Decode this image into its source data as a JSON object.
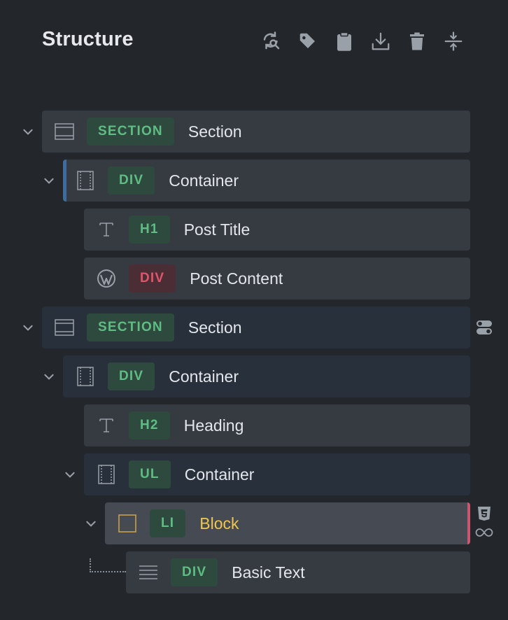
{
  "panel": {
    "title": "Structure"
  },
  "toolbar": [
    {
      "name": "refresh-search-icon"
    },
    {
      "name": "tag-icon"
    },
    {
      "name": "clipboard-icon"
    },
    {
      "name": "download-icon"
    },
    {
      "name": "trash-icon"
    },
    {
      "name": "expand-collapse-icon"
    }
  ],
  "tree": {
    "row1": {
      "tag": "SECTION",
      "label": "Section",
      "icon": "section-icon"
    },
    "row2": {
      "tag": "DIV",
      "label": "Container",
      "icon": "container-icon"
    },
    "row3": {
      "tag": "H1",
      "label": "Post Title",
      "icon": "text-icon"
    },
    "row4": {
      "tag": "DIV",
      "label": "Post Content",
      "icon": "wordpress-icon"
    },
    "row5": {
      "tag": "SECTION",
      "label": "Section",
      "icon": "section-icon"
    },
    "row6": {
      "tag": "DIV",
      "label": "Container",
      "icon": "container-icon"
    },
    "row7": {
      "tag": "H2",
      "label": "Heading",
      "icon": "text-icon"
    },
    "row8": {
      "tag": "UL",
      "label": "Container",
      "icon": "container-icon"
    },
    "row9": {
      "tag": "LI",
      "label": "Block",
      "icon": "block-icon"
    },
    "row10": {
      "tag": "DIV",
      "label": "Basic Text",
      "icon": "paragraph-icon"
    }
  },
  "colors": {
    "background": "#23262b",
    "row": "#363a41",
    "row_highlight": "#28303b",
    "row_selected": "#454a53",
    "tag_green": "#5fbd84",
    "tag_red": "#e2546b",
    "label_selected": "#f0c64e",
    "selected_border": "#c9576f",
    "left_accent": "#3d6d9e"
  }
}
